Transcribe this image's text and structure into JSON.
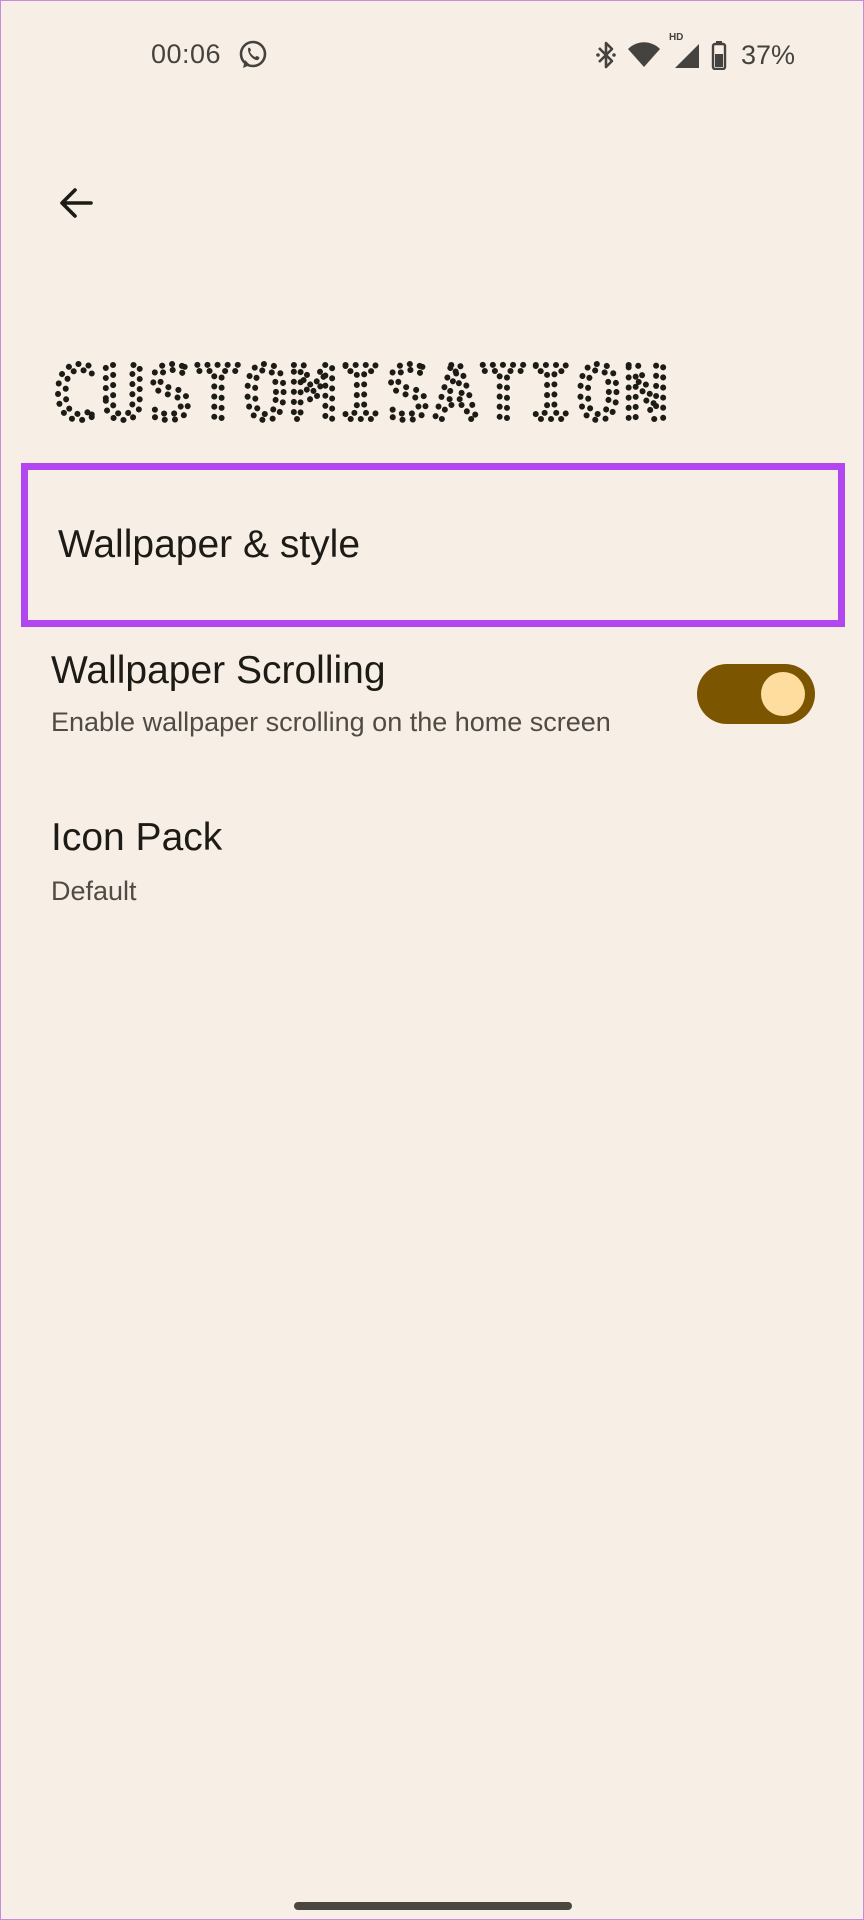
{
  "status_bar": {
    "time": "00:06",
    "hd_label": "HD",
    "battery_percent": "37%",
    "icons": [
      "whatsapp-icon",
      "bluetooth-icon",
      "wifi-icon",
      "signal-icon",
      "battery-icon"
    ]
  },
  "header": {
    "back_icon": "arrow-left-icon",
    "title": "CUSTOMISATION"
  },
  "settings": {
    "wallpaper_style": {
      "title": "Wallpaper & style",
      "highlight_color": "#b347ef"
    },
    "wallpaper_scrolling": {
      "title": "Wallpaper Scrolling",
      "subtitle": "Enable wallpaper scrolling on the home screen",
      "enabled": true
    },
    "icon_pack": {
      "title": "Icon Pack",
      "value": "Default"
    }
  },
  "colors": {
    "background": "#f7efe6",
    "toggle_track": "#7c5500",
    "toggle_thumb": "#ffdd9e"
  }
}
